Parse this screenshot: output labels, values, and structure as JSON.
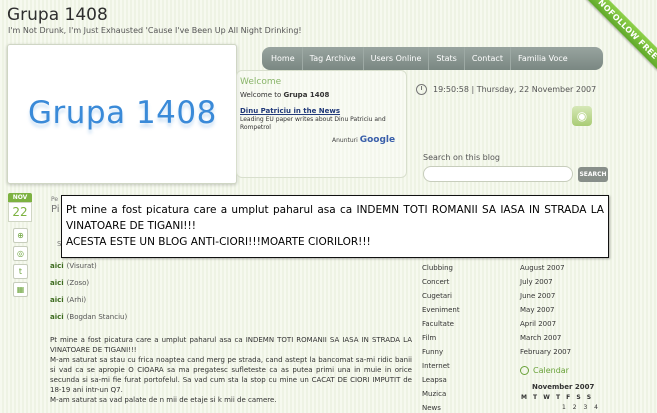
{
  "site": {
    "title": "Grupa 1408",
    "tagline": "I'm Not Drunk, I'm Just Exhausted 'Cause I've Been Up All Night Drinking!",
    "logo_text": "Grupa 1408",
    "ribbon": "NOFOLLOW FREE"
  },
  "nav": {
    "items": [
      "Home",
      "Tag Archive",
      "Users Online",
      "Stats",
      "Contact",
      "Familia Voce"
    ]
  },
  "welcome": {
    "heading": "Welcome",
    "line_prefix": "Welcome to ",
    "line_site": "Grupa 1408",
    "ad_title": "Dinu Patriciu in the News",
    "ad_text": "Leading EU paper writes about Dinu Patriciu and Rompetrol",
    "ad_footer": "Anunturi",
    "ad_brand": "Google"
  },
  "clock": {
    "text": "19:50:58 | Thursday, 22 November 2007"
  },
  "search": {
    "label": "Search on this blog",
    "button": "SEARCH"
  },
  "post": {
    "month": "NOV",
    "day": "22",
    "frag1": "Pe",
    "frag2": "Pi",
    "frag3": "S",
    "links": [
      {
        "link": "aici",
        "who": "(Visurat)"
      },
      {
        "link": "aici",
        "who": "(Zoso)"
      },
      {
        "link": "aici",
        "who": "(Arhi)"
      },
      {
        "link": "aici",
        "who": "(Bogdan Stanciu)"
      }
    ],
    "body_1": "Pt mine a fost picatura care a umplut paharul asa ca INDEMN TOTI ROMANII SA IASA IN STRADA LA VINATOARE DE TIGANI!!!",
    "body_2": "M-am saturat sa stau cu frica noaptea cand merg pe strada, cand astept la bancomat sa-mi ridic banii si vad ca se apropie O CIOARA sa ma pregatesc sufleteste ca as putea primi una in muie in orice secunda si sa-mi fie furat portofelul. Sa vad cum sta la stop cu mine un CACAT DE CIORI IMPUTIT de 18-19 ani intr-un Q7.",
    "body_3": "M-am saturat sa vad palate de n mii de etaje si k mii de camere."
  },
  "popup": {
    "line1": "Pt mine a fost picatura care a umplut paharul asa ca INDEMN TOTI ROMANII SA IASA IN STRADA LA VINATOARE DE TIGANI!!!",
    "line2": "ACESTA ESTE UN BLOG ANTI-CIORI!!!MOARTE CIORILOR!!!"
  },
  "categories": [
    "Clubbing",
    "Concert",
    "Cugetari",
    "Eveniment",
    "Facultate",
    "Film",
    "Funny",
    "Internet",
    "Leapsa",
    "Muzica",
    "News"
  ],
  "archives": [
    "August 2007",
    "July 2007",
    "June 2007",
    "May 2007",
    "April 2007",
    "March 2007",
    "February 2007"
  ],
  "calendar": {
    "heading": "Calendar",
    "month": "November 2007",
    "days_header": "M T W T F S S",
    "first_row": "1 2 3 4"
  },
  "colors": {
    "accent": "#7db241",
    "nav_bg": "#8a9691",
    "logo": "#3a8ad8"
  }
}
